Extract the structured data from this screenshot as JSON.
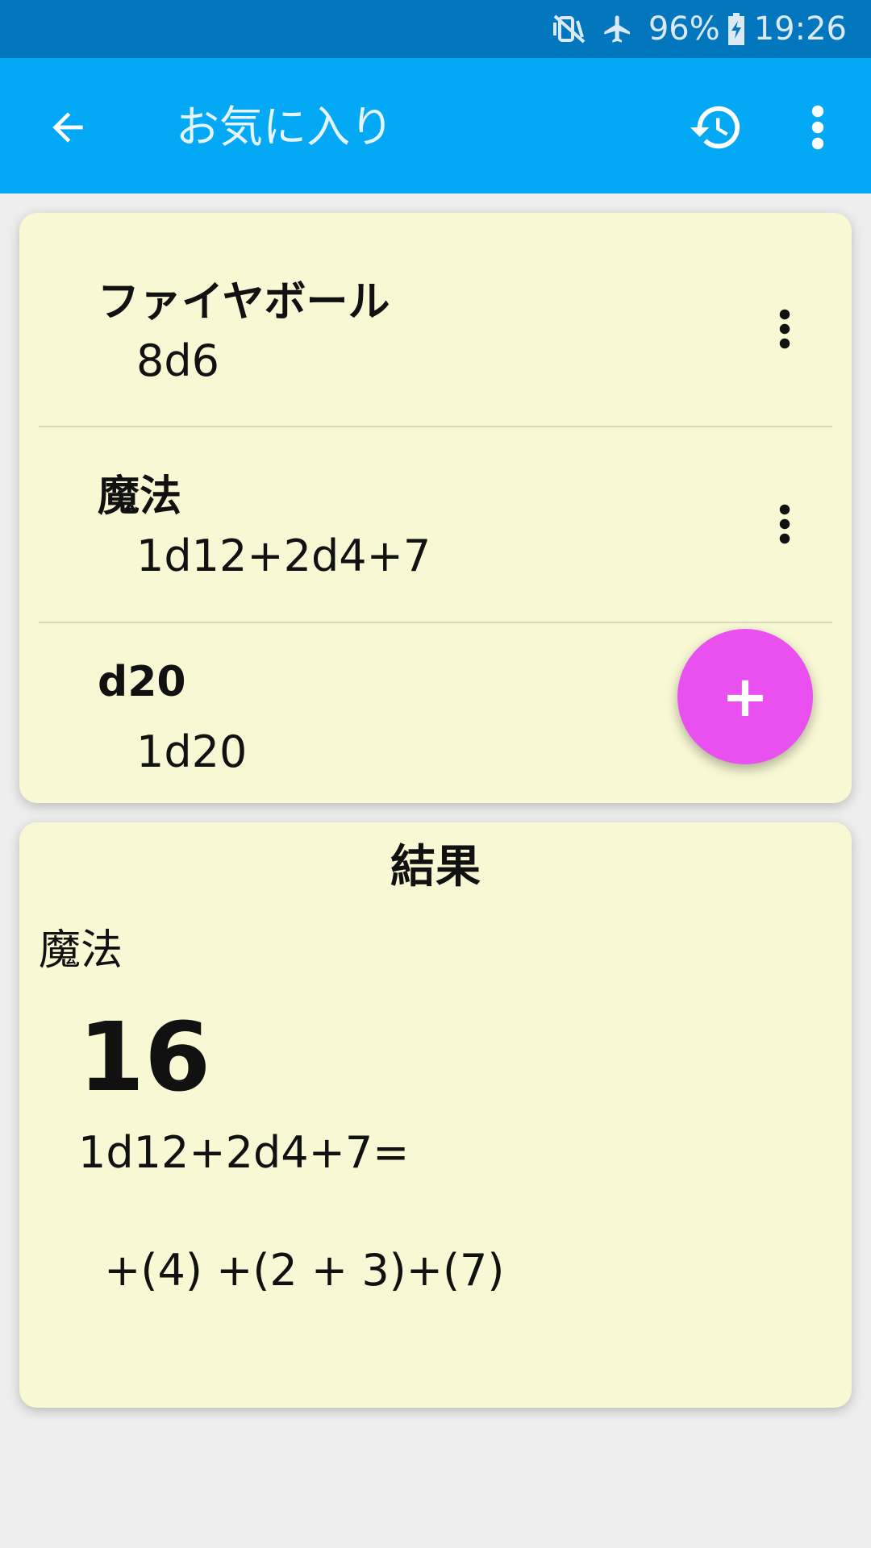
{
  "status_bar": {
    "battery": "96%",
    "time": "19:26",
    "icons": [
      "vibrate-mute-icon",
      "airplane-icon",
      "battery-charging-icon"
    ]
  },
  "app_bar": {
    "title": "お気に入り",
    "icons": [
      "back-arrow-icon",
      "history-icon",
      "overflow-menu-icon"
    ]
  },
  "favorites": [
    {
      "name": "ファイヤボール",
      "formula": "8d6"
    },
    {
      "name": "魔法",
      "formula": "1d12+2d4+7"
    },
    {
      "name": "d20",
      "formula": "1d20"
    }
  ],
  "fab": {
    "label": "+"
  },
  "result": {
    "header": "結果",
    "name": "魔法",
    "total": "16",
    "expression": "1d12+2d4+7=",
    "breakdown": " +(4) +(2 + 3)+(7)"
  },
  "colors": {
    "status_bar": "#0277bd",
    "app_bar": "#03a9f4",
    "card": "#f8f8d5",
    "fab": "#ea4ff0",
    "background": "#eeeeee"
  }
}
